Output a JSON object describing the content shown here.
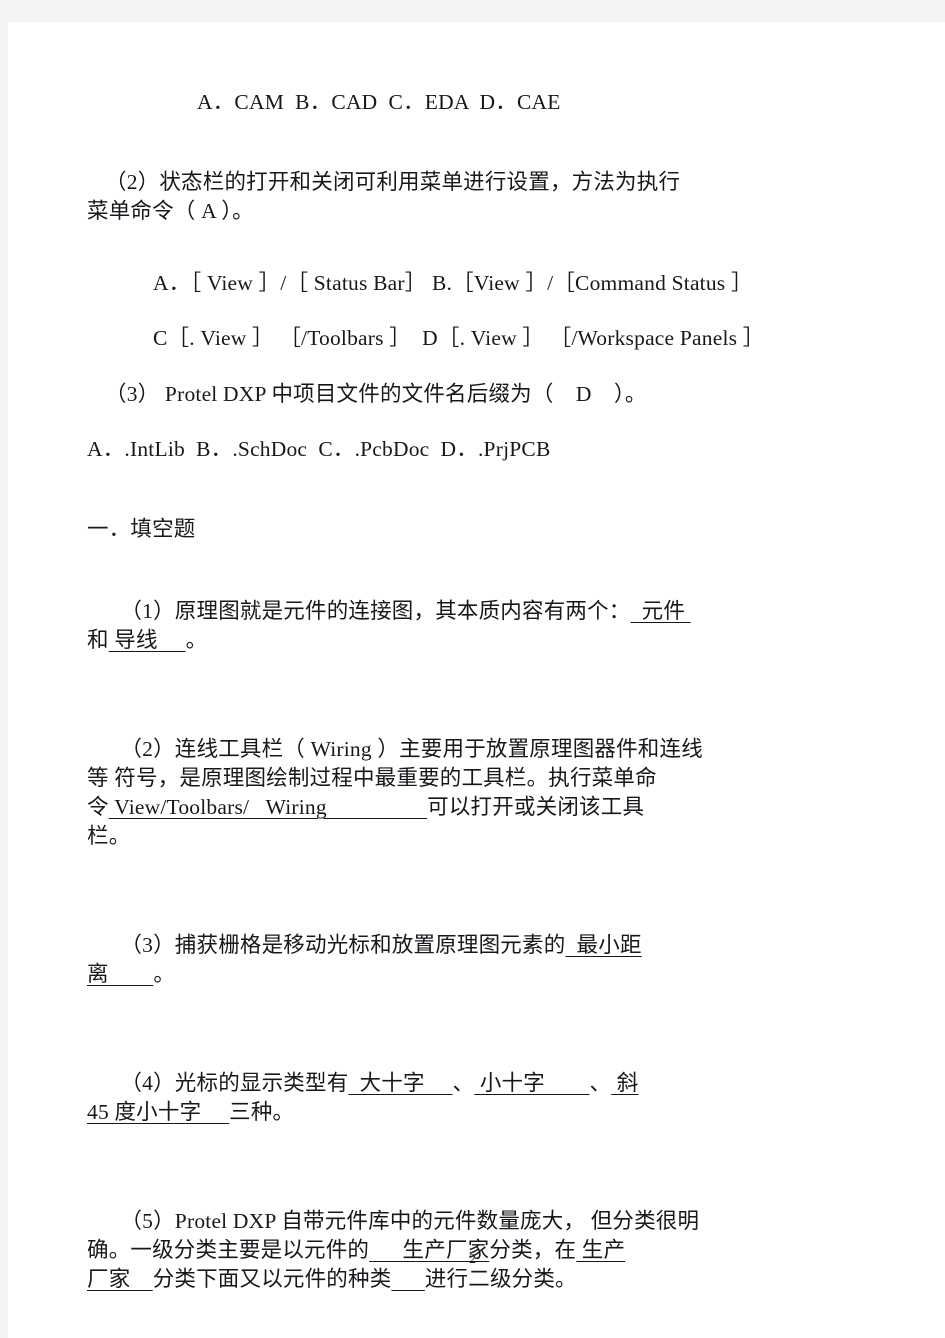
{
  "page": {
    "number": "2",
    "paper_color": "#ffffff",
    "scan_margin_color": "#f4f4f4",
    "text_color": "#18181c"
  },
  "multiple_choice": {
    "q1_options_line": "A．CAM  B．CAD  C．EDA  D．CAE",
    "q2": {
      "stem_line1": "（2）状态栏的打开和关闭可利用菜单进行设置，方法为执行",
      "stem_line2": "菜单命令（ A ）。",
      "options_line_ab": "A．［ View ］/［ Status Bar］ B.［View ］/［Command Status ］",
      "options_line_cd": "C［. View ］ ［/Toolbars ］  D［. View ］ ［/Workspace Panels ］"
    },
    "q3": {
      "stem": "（3） Protel DXP 中项目文件的文件名后缀为（    D    ）。",
      "options_line": "A．.IntLib  B．.SchDoc  C．.PcbDoc  D．.PrjPCB"
    }
  },
  "fill_in_blank": {
    "section_heading": "一．填空题",
    "items": [
      {
        "id": "1",
        "seg_a": "（1）原理图就是元件的连接图，其本质内容有两个：",
        "blank_1": "  元件 ",
        "seg_b": "\n和",
        "blank_2": " 导线     ",
        "seg_c": "。"
      },
      {
        "id": "2",
        "seg_a": "（2）连线工具栏（ Wiring ）主要用于放置原理图器件和连线\n等 符号，是原理图绘制过程中最重要的工具栏。执行菜单命\n令",
        "blank_1": " View/Toolbars/   Wiring                  ",
        "seg_b": "可以打开或关闭该工具\n栏。"
      },
      {
        "id": "3",
        "seg_a": "（3）捕获栅格是移动光标和放置原理图元素的",
        "blank_1": "  最小距",
        "seg_b": "\n",
        "blank_2": "离        ",
        "seg_c": "。"
      },
      {
        "id": "4",
        "seg_a": "（4）光标的显示类型有",
        "blank_1": "  大十字     ",
        "seg_b": "、",
        "blank_2": " 小十字        ",
        "seg_c": "、",
        "blank_3": " 斜",
        "seg_d": "\n",
        "blank_4": "45 度小十字     ",
        "seg_e": "三种。"
      },
      {
        "id": "5",
        "seg_a": "（5）Protel DXP 自带元件库中的元件数量庞大， 但分类很明\n确。一级分类主要是以元件的",
        "blank_1": "      生产厂家",
        "seg_b": "分类，在",
        "blank_2": " 生产",
        "seg_c": "\n",
        "blank_3": "厂家    ",
        "seg_d": "分类下面又以元件的种类",
        "blank_4": "      ",
        "seg_e": "进行二级分类。"
      }
    ]
  }
}
